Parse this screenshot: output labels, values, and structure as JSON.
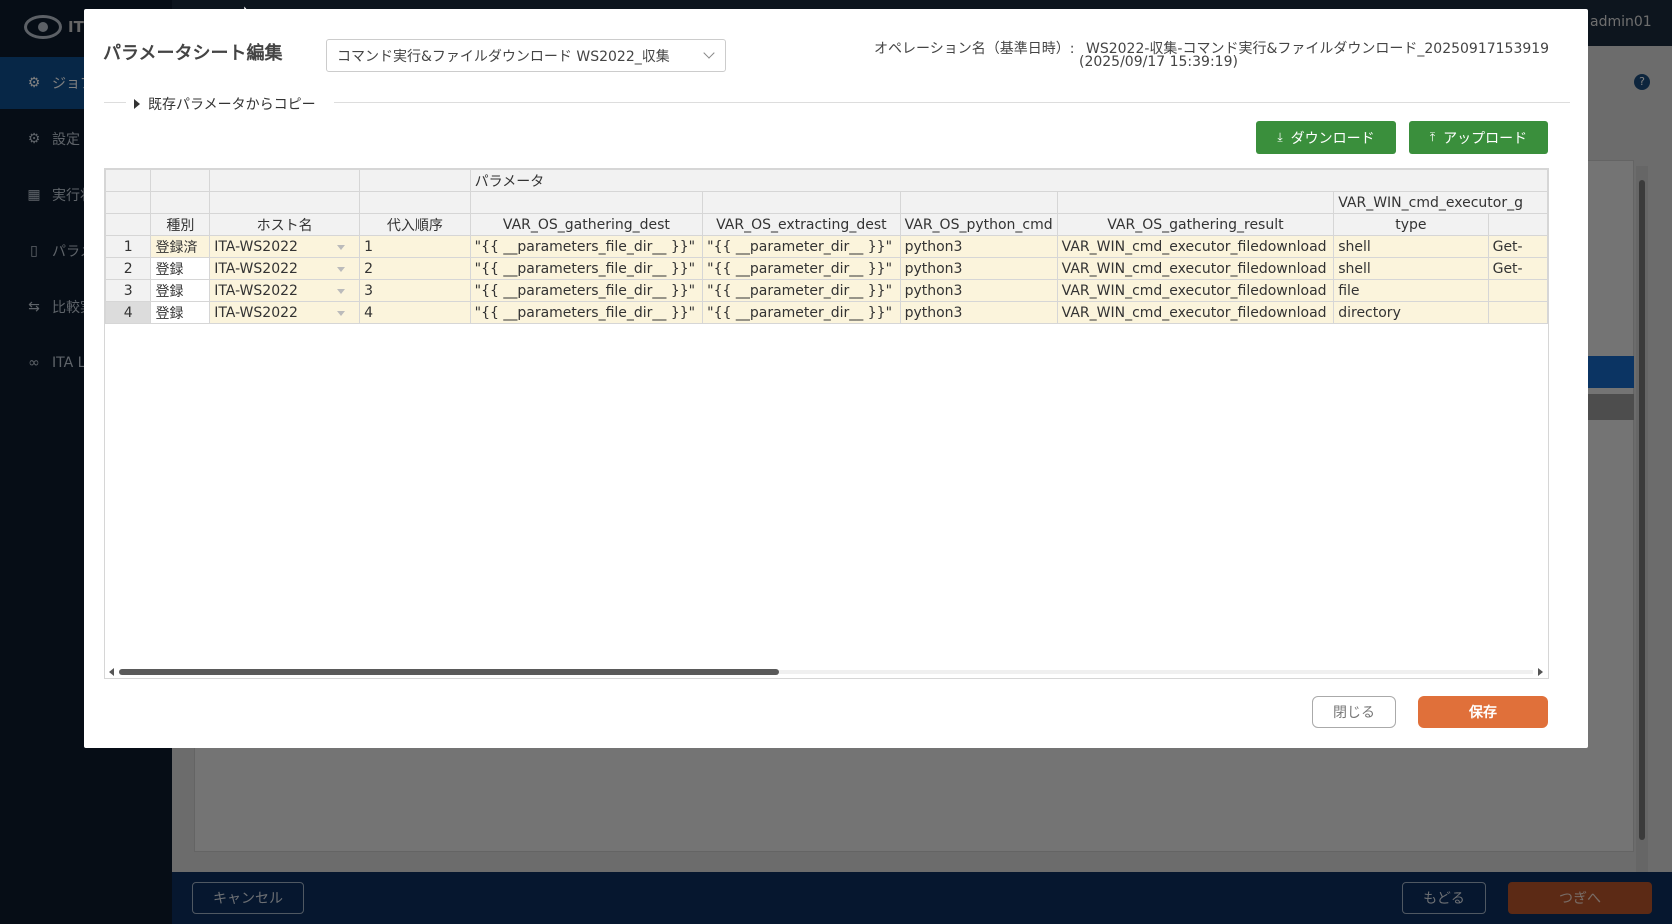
{
  "app": {
    "user": "admin01",
    "logo_text": "IT",
    "nav": [
      {
        "label": "ジョブ"
      },
      {
        "label": "設定"
      },
      {
        "label": "実行状"
      },
      {
        "label": "パラメ"
      },
      {
        "label": "比較実"
      },
      {
        "label": "ITA L"
      }
    ],
    "footer": {
      "cancel": "キャンセル",
      "back": "もどる",
      "next": "つぎへ"
    }
  },
  "modal": {
    "title": "パラメータシート編集",
    "sheet_select_value": "コマンド実行&ファイルダウンロード WS2022_収集",
    "operation_label": "オペレーション名（基準日時）:",
    "operation_name": "WS2022-収集-コマンド実行&ファイルダウンロード_20250917153919",
    "operation_date": "(2025/09/17 15:39:19)",
    "copy_toggle": "既存パラメータからコピー",
    "download_label": "ダウンロード",
    "upload_label": "アップロード",
    "close_label": "閉じる",
    "save_label": "保存"
  },
  "grid": {
    "group_header": "パラメータ",
    "group2_header": "VAR_WIN_cmd_executor_g",
    "columns": [
      "種別",
      "ホスト名",
      "代入順序",
      "VAR_OS_gathering_dest",
      "VAR_OS_extracting_dest",
      "VAR_OS_python_cmd",
      "VAR_OS_gathering_result",
      "type",
      ""
    ],
    "rows": [
      {
        "num": "1",
        "kind": "登録済",
        "host": "ITA-WS2022",
        "order": "1",
        "gathering_dest": "\"{{ __parameters_file_dir__ }}\"",
        "extracting_dest": "\"{{ __parameter_dir__ }}\"",
        "python_cmd": "python3",
        "gathering_result": "VAR_WIN_cmd_executor_filedownload",
        "type": "shell",
        "extra": "Get-"
      },
      {
        "num": "2",
        "kind": "登録",
        "host": "ITA-WS2022",
        "order": "2",
        "gathering_dest": "\"{{ __parameters_file_dir__ }}\"",
        "extracting_dest": "\"{{ __parameter_dir__ }}\"",
        "python_cmd": "python3",
        "gathering_result": "VAR_WIN_cmd_executor_filedownload",
        "type": "shell",
        "extra": "Get-"
      },
      {
        "num": "3",
        "kind": "登録",
        "host": "ITA-WS2022",
        "order": "3",
        "gathering_dest": "\"{{ __parameters_file_dir__ }}\"",
        "extracting_dest": "\"{{ __parameter_dir__ }}\"",
        "python_cmd": "python3",
        "gathering_result": "VAR_WIN_cmd_executor_filedownload",
        "type": "file",
        "extra": ""
      },
      {
        "num": "4",
        "kind": "登録",
        "host": "ITA-WS2022",
        "order": "4",
        "gathering_dest": "\"{{ __parameters_file_dir__ }}\"",
        "extracting_dest": "\"{{ __parameter_dir__ }}\"",
        "python_cmd": "python3",
        "gathering_result": "VAR_WIN_cmd_executor_filedownload",
        "type": "directory",
        "extra": ""
      }
    ]
  },
  "colors": {
    "primary_green": "#3a8f3c",
    "save_orange": "#e0703a",
    "row_fill": "#fbf4dc",
    "nav_active": "#0f4f8f"
  }
}
